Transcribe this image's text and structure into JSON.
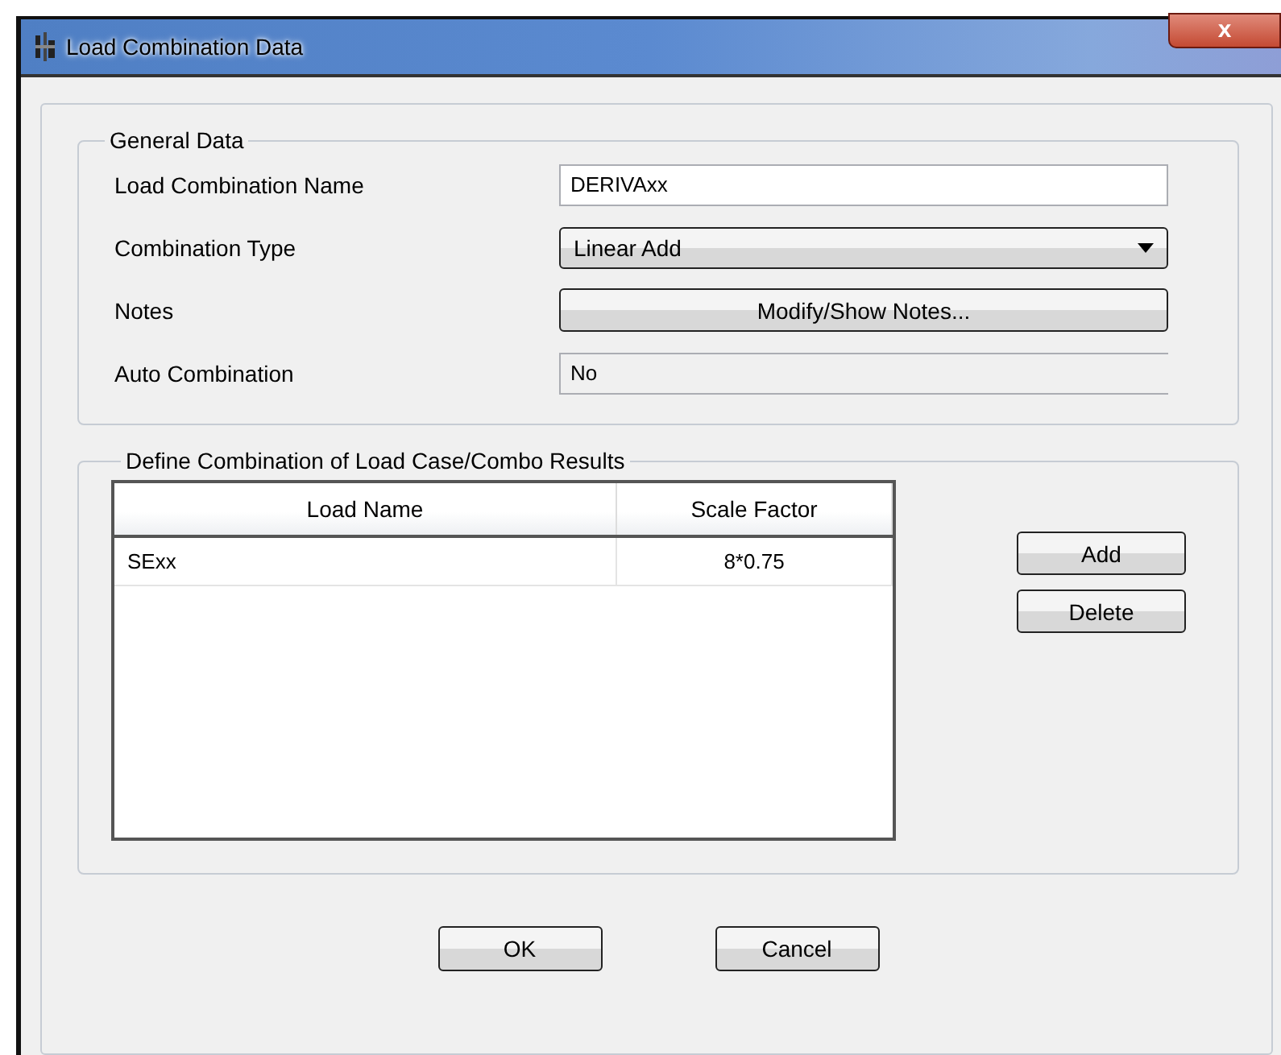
{
  "window": {
    "title": "Load Combination Data",
    "close": "x"
  },
  "general_data": {
    "title": "General Data",
    "fields": [
      {
        "kind": "text",
        "label": "Load Combination Name",
        "value": "DERIVAxx"
      },
      {
        "kind": "dropdown",
        "label": "Combination Type",
        "value": "Linear Add"
      },
      {
        "kind": "button",
        "label": "Notes",
        "value": "Modify/Show Notes..."
      },
      {
        "kind": "readonly",
        "label": "Auto Combination",
        "value": "No"
      }
    ]
  },
  "combination": {
    "title": "Define Combination of Load Case/Combo Results",
    "columns": [
      "Load Name",
      "Scale Factor"
    ],
    "rows": [
      {
        "cells": [
          "SExx",
          "8*0.75"
        ]
      }
    ],
    "buttons": [
      "Add",
      "Delete"
    ]
  },
  "buttons": [
    "OK",
    "Cancel"
  ]
}
